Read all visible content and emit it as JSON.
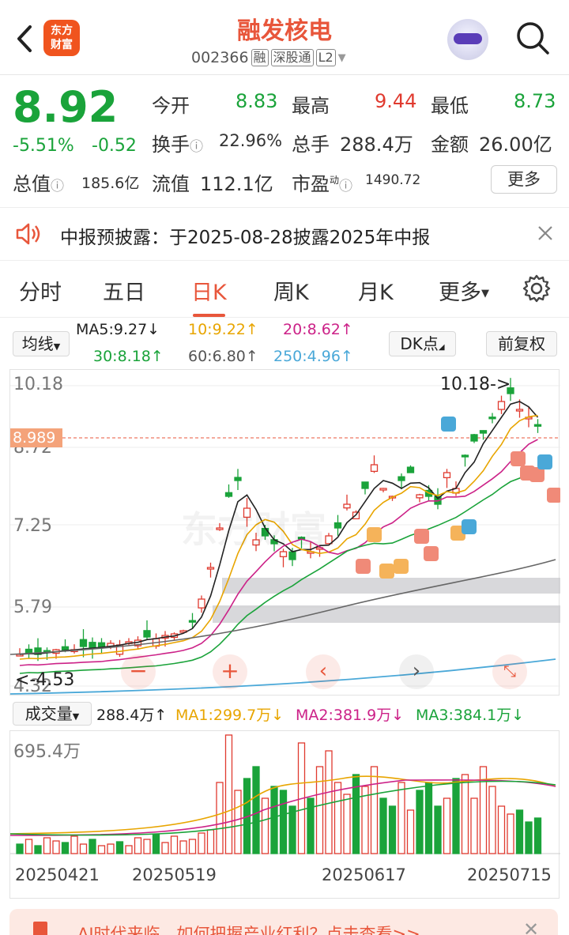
{
  "header": {
    "logo_line1": "东方",
    "logo_line2": "财富",
    "title": "融发核电",
    "code": "002366",
    "tags": [
      "融",
      "深股通",
      "L2"
    ]
  },
  "quote": {
    "price": "8.92",
    "pct": "-5.51%",
    "change": "-0.52",
    "open_label": "今开",
    "open": "8.83",
    "high_label": "最高",
    "high": "9.44",
    "low_label": "最低",
    "low": "8.73",
    "turnover_label": "换手",
    "turnover": "22.96%",
    "volume_label": "总手",
    "volume": "288.4万",
    "amount_label": "金额",
    "amount": "26.00亿",
    "mktcap_label": "总值",
    "mktcap": "185.6亿",
    "float_label": "流值",
    "float": "112.1亿",
    "pe_label": "市盈",
    "pe_sup": "动",
    "pe": "1490.72",
    "more": "更多"
  },
  "notice": {
    "text": "中报预披露：于2025-08-28披露2025年中报"
  },
  "tabs": [
    "分时",
    "五日",
    "日K",
    "周K",
    "月K",
    "更多"
  ],
  "indicators": {
    "selector": "均线",
    "ma5": "MA5:9.27↓",
    "ma10": "10:9.22↑",
    "ma20": "20:8.62↑",
    "ma30": "30:8.18↑",
    "ma60": "60:6.80↑",
    "ma250": "250:4.96↑",
    "dk": "DK点",
    "fq": "前复权"
  },
  "kline": {
    "y_labels": [
      "10.18",
      "8.72",
      "7.25",
      "5.79",
      "4.32"
    ],
    "last_price_tag": "8.989",
    "high_marker": "10.18->",
    "low_marker": "<-4.53",
    "watermark": "东方财富"
  },
  "volume": {
    "selector": "成交量",
    "vol": "288.4万↑",
    "ma1": "MA1:299.7万↓",
    "ma2": "MA2:381.9万↓",
    "ma3": "MA3:384.1万↓",
    "max_label": "695.4万",
    "dates": [
      "20250421",
      "20250519",
      "20250617",
      "20250715"
    ]
  },
  "banner": {
    "text": "AI时代来临，如何把握产业红利？点击查看>>"
  },
  "colors": {
    "up": "#e03a2f",
    "down": "#1aa33a",
    "accent": "#e8563b"
  }
}
